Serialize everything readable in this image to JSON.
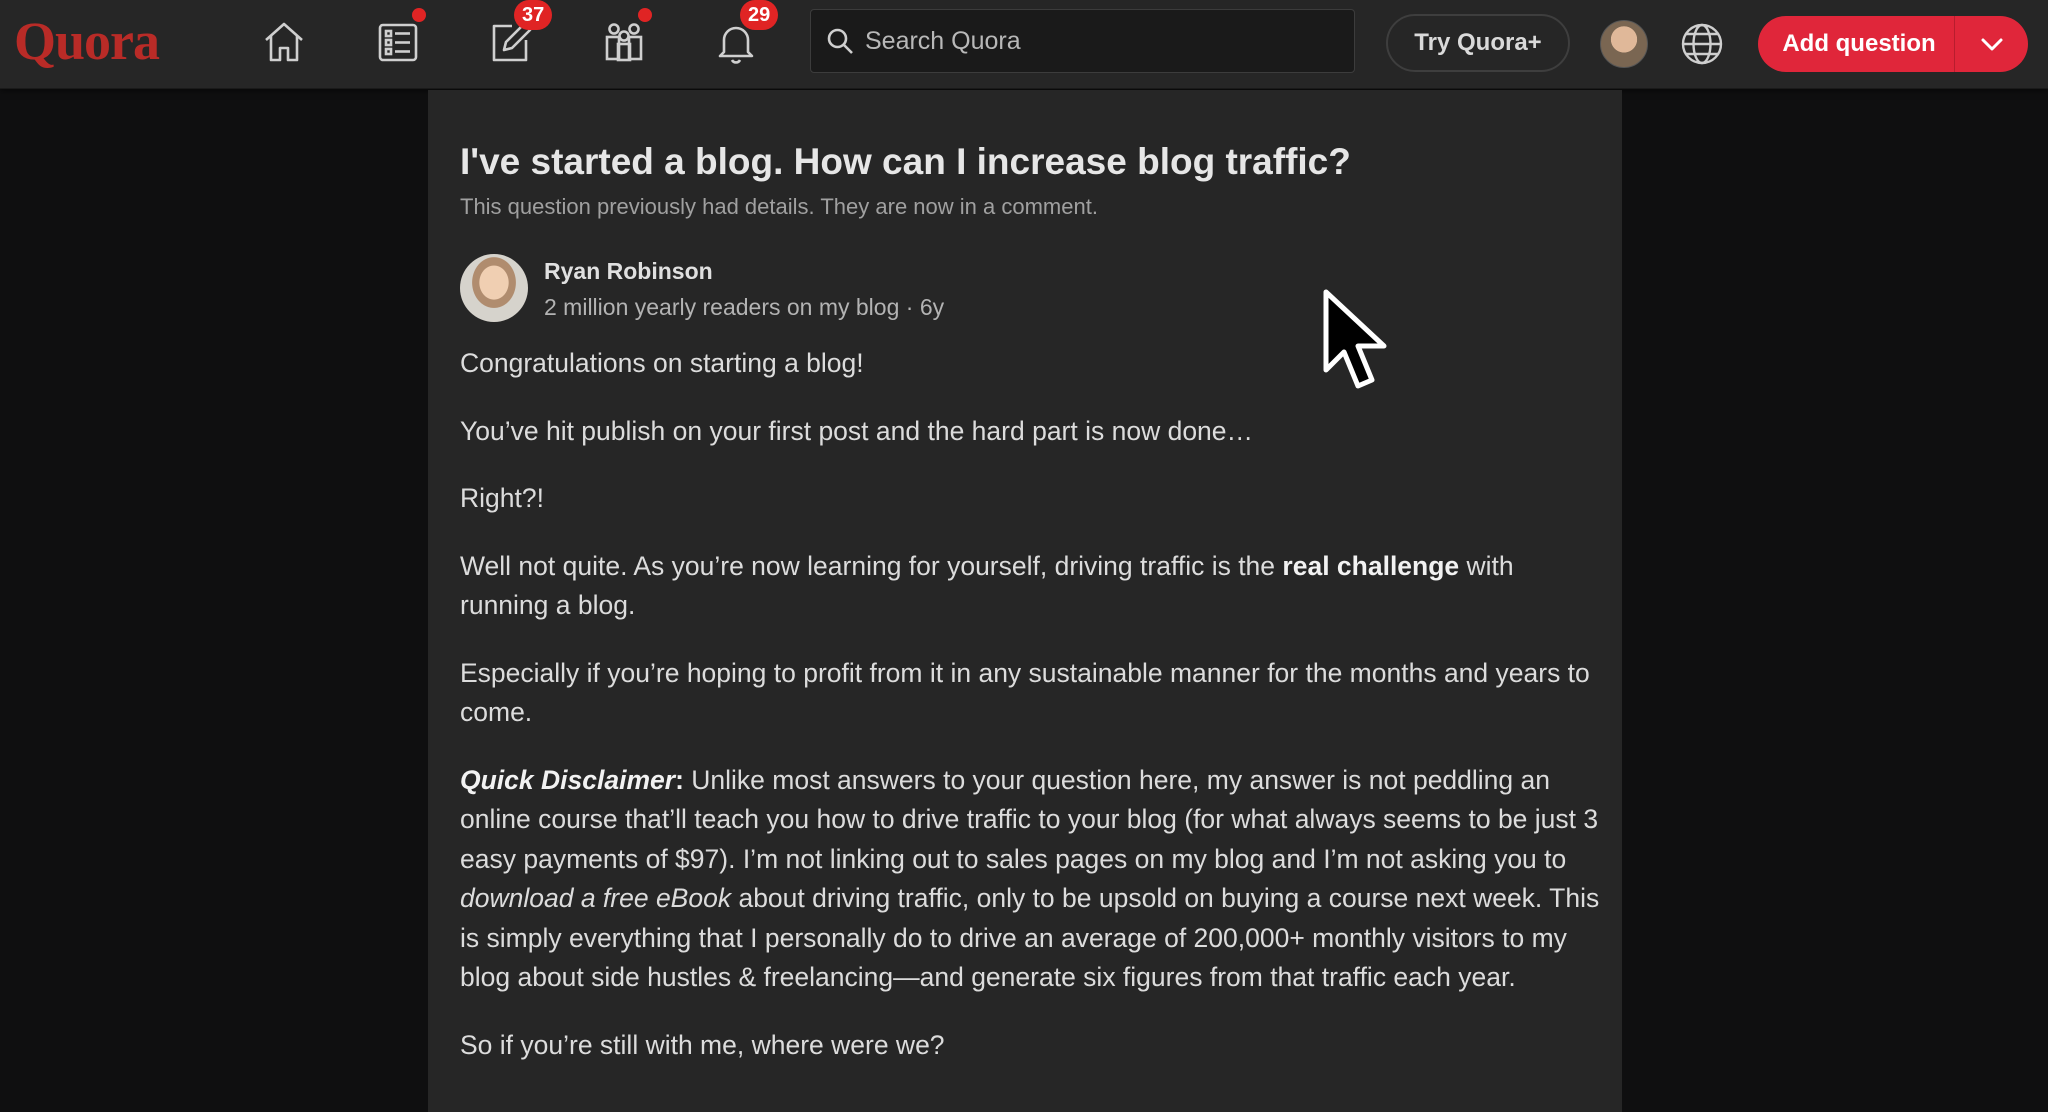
{
  "nav": {
    "logo": "Quora",
    "answer_badge": "37",
    "notifications_badge": "29",
    "search_placeholder": "Search Quora",
    "try_plus": "Try Quora+",
    "add_question": "Add question"
  },
  "question": {
    "title": "I've started a blog. How can I increase blog traffic?",
    "note": "This question previously had details. They are now in a comment."
  },
  "answer": {
    "author_name": "Ryan Robinson",
    "author_meta": "2 million yearly readers on my blog · 6y",
    "p1": "Congratulations on starting a blog!",
    "p2": "You’ve hit publish on your first post and the hard part is now done…",
    "p3": "Right?!",
    "p4_a": "Well not quite. As you’re now learning for yourself, driving traffic is the ",
    "p4_bold": "real challenge",
    "p4_b": " with running a blog.",
    "p5": "Especially if you’re hoping to profit from it in any sustainable manner for the months and years to come.",
    "p6_label": "Quick Disclaimer",
    "p6_colon": ":",
    "p6_a": " Unlike most answers to your question here, my answer is not peddling an online course that’ll teach you how to drive traffic to your blog (for what always seems to be just 3 easy payments of $97). I’m not linking out to sales pages on my blog and I’m not asking you to ",
    "p6_italic": "download a free eBook",
    "p6_b": " about driving traffic, only to be upsold on buying a course next week. This is simply everything that I personally do to drive an average of 200,000+ monthly visitors to my blog about side hustles & freelancing—and generate six figures from that traffic each year.",
    "p7": "So if you’re still with me, where were we?"
  },
  "colors": {
    "brand": "#b92b27",
    "accent": "#e0263a",
    "badge": "#e02424",
    "card_bg": "#262626",
    "page_bg": "#0f0f10"
  },
  "icons": [
    "home-icon",
    "following-icon",
    "answer-icon",
    "spaces-icon",
    "bell-icon",
    "search-icon",
    "globe-icon",
    "chevron-down-icon",
    "mouse-cursor-icon"
  ]
}
